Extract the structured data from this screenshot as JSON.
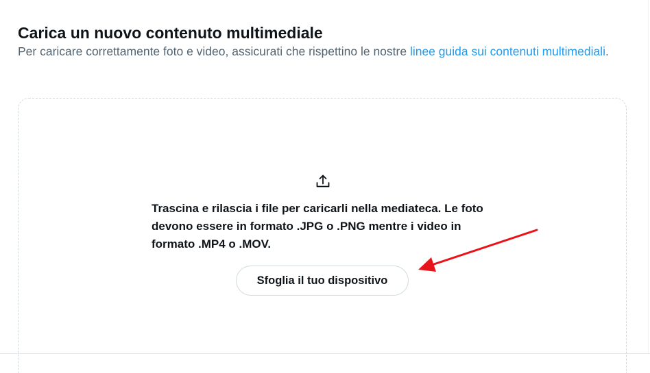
{
  "header": {
    "title": "Carica un nuovo contenuto multimediale",
    "subtitle_text": "Per caricare correttamente foto e video, assicurati che rispettino le nostre ",
    "subtitle_link": "linee guida sui contenuti multimediali",
    "subtitle_end": "."
  },
  "dropzone": {
    "icon": "upload-icon",
    "instructions": "Trascina e rilascia i file per caricarli nella mediateca. Le foto devono essere in formato .JPG o .PNG mentre i video in formato .MP4 o .MOV.",
    "browse_label": "Sfoglia il tuo dispositivo"
  },
  "colors": {
    "link": "#1d9bf0",
    "annotation_arrow": "#e8141b",
    "text_primary": "#0f1419",
    "text_secondary": "#536471",
    "border": "#cfd9de"
  }
}
